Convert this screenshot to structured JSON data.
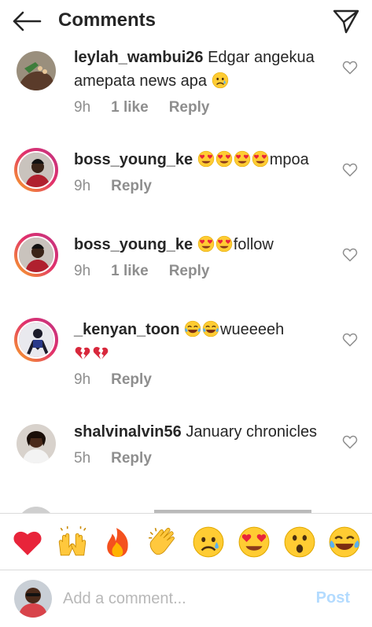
{
  "header": {
    "title": "Comments",
    "back_icon": "arrow-left-icon",
    "share_icon": "paper-plane-icon"
  },
  "colors": {
    "ring_start": "#f9a825",
    "ring_mid": "#e1306c",
    "ring_end": "#c13584",
    "meta": "#8e8e8e",
    "post_disabled": "#b3dbff"
  },
  "comments": [
    {
      "username": "leylah_wambui26",
      "text1": "Edgar angekua",
      "text2": "amepata news apa",
      "emojis_end": [
        "sad-tear"
      ],
      "time": "9h",
      "likes": "1 like",
      "reply": "Reply"
    },
    {
      "username": "boss_young_ke",
      "emojis_start": [
        "heart-eyes",
        "heart-eyes",
        "heart-eyes",
        "heart-eyes"
      ],
      "text1": "mpoa",
      "time": "9h",
      "reply": "Reply"
    },
    {
      "username": "boss_young_ke",
      "emojis_start": [
        "heart-eyes",
        "heart-eyes"
      ],
      "text1": "follow",
      "time": "9h",
      "likes": "1 like",
      "reply": "Reply"
    },
    {
      "username": "_kenyan_toon",
      "emojis_start": [
        "joy",
        "joy"
      ],
      "text1": "wueeeeh",
      "line2_emojis": [
        "broken-heart",
        "broken-heart"
      ],
      "time": "9h",
      "reply": "Reply"
    },
    {
      "username": "shalvinalvin56",
      "text1": "January chronicles",
      "time": "5h",
      "reply": "Reply"
    }
  ],
  "quick_emojis": [
    "red-heart-icon",
    "raising-hands-icon",
    "fire-icon",
    "clapping-hands-icon",
    "sad-tear-icon",
    "heart-eyes-icon",
    "surprised-face-icon",
    "tears-of-joy-icon"
  ],
  "composer": {
    "placeholder": "Add a comment...",
    "post_label": "Post"
  }
}
